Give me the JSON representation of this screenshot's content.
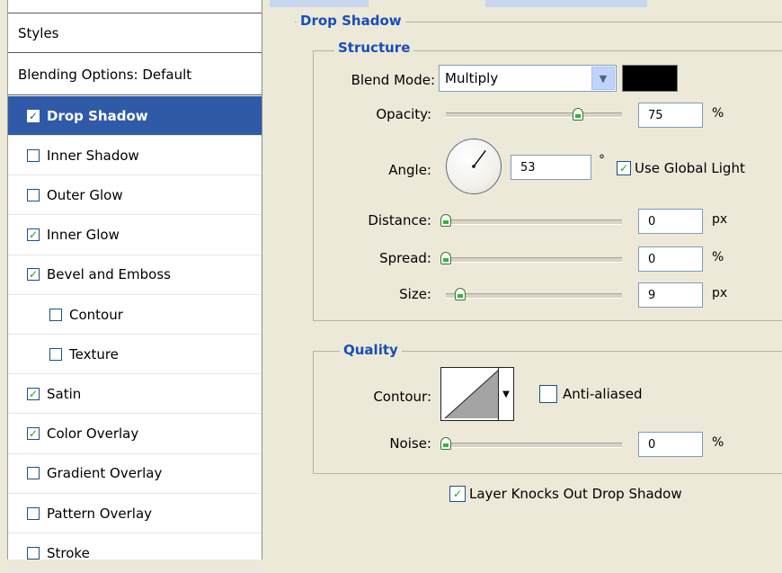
{
  "styles_panel": {
    "header": "Styles",
    "blending": "Blending Options: Default",
    "items": [
      {
        "label": "Drop Shadow",
        "checked": true,
        "selected": true,
        "indent": false
      },
      {
        "label": "Inner Shadow",
        "checked": false,
        "selected": false,
        "indent": false
      },
      {
        "label": "Outer Glow",
        "checked": false,
        "selected": false,
        "indent": false
      },
      {
        "label": "Inner Glow",
        "checked": true,
        "selected": false,
        "indent": false
      },
      {
        "label": "Bevel and Emboss",
        "checked": true,
        "selected": false,
        "indent": false
      },
      {
        "label": "Contour",
        "checked": false,
        "selected": false,
        "indent": true
      },
      {
        "label": "Texture",
        "checked": false,
        "selected": false,
        "indent": true
      },
      {
        "label": "Satin",
        "checked": true,
        "selected": false,
        "indent": false
      },
      {
        "label": "Color Overlay",
        "checked": true,
        "selected": false,
        "indent": false
      },
      {
        "label": "Gradient Overlay",
        "checked": false,
        "selected": false,
        "indent": false
      },
      {
        "label": "Pattern Overlay",
        "checked": false,
        "selected": false,
        "indent": false
      },
      {
        "label": "Stroke",
        "checked": false,
        "selected": false,
        "indent": false
      }
    ]
  },
  "drop_shadow": {
    "title": "Drop Shadow",
    "structure": {
      "title": "Structure",
      "blend_mode_label": "Blend Mode:",
      "blend_mode_value": "Multiply",
      "shadow_color": "#000000",
      "opacity_label": "Opacity:",
      "opacity_value": "75",
      "opacity_unit": "%",
      "opacity_level": 0.75,
      "angle_label": "Angle:",
      "angle_value": "53",
      "angle_unit": "°",
      "angle_degrees": 53,
      "use_global_light_label": "Use Global Light",
      "use_global_light_checked": true,
      "distance_label": "Distance:",
      "distance_value": "0",
      "distance_unit": "px",
      "spread_label": "Spread:",
      "spread_value": "0",
      "spread_unit": "%",
      "size_label": "Size:",
      "size_value": "9",
      "size_unit": "px"
    },
    "quality": {
      "title": "Quality",
      "contour_label": "Contour:",
      "anti_aliased_label": "Anti-aliased",
      "anti_aliased_checked": false,
      "noise_label": "Noise:",
      "noise_value": "0",
      "noise_unit": "%"
    },
    "knockout_label": "Layer Knocks Out Drop Shadow",
    "knockout_checked": true
  },
  "colors": {
    "selected_row": "#2f5aa7",
    "section_title": "#1a4db8",
    "check_mark": "#21a121"
  }
}
